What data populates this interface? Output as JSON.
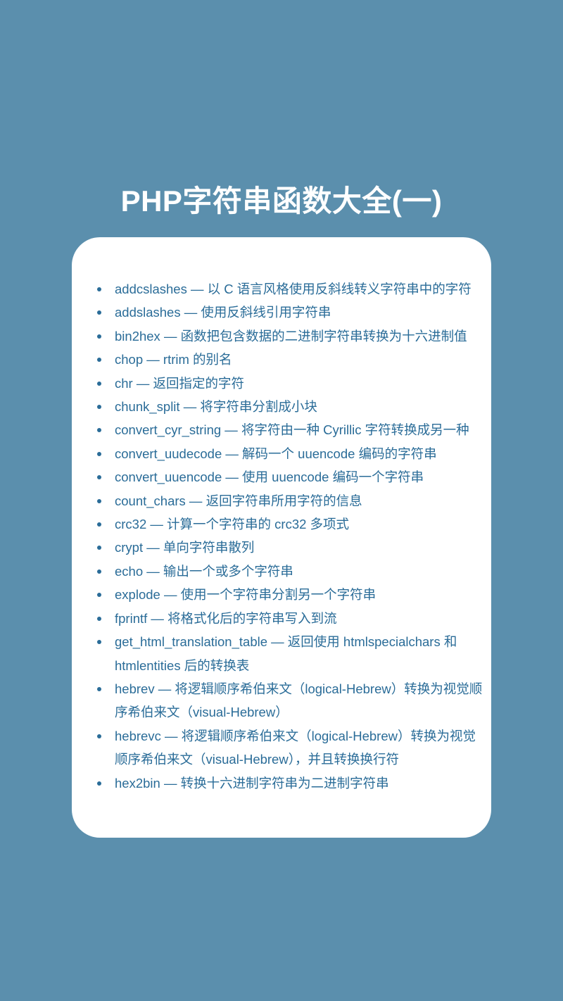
{
  "title": "PHP字符串函数大全(一)",
  "colors": {
    "background": "#5b8fad",
    "card": "#ffffff",
    "text": "#2a6c98",
    "title": "#ffffff"
  },
  "functions": [
    {
      "name": "addcslashes",
      "desc": "以 C 语言风格使用反斜线转义字符串中的字符"
    },
    {
      "name": "addslashes",
      "desc": "使用反斜线引用字符串"
    },
    {
      "name": "bin2hex",
      "desc": "函数把包含数据的二进制字符串转换为十六进制值"
    },
    {
      "name": "chop",
      "desc": "rtrim 的别名"
    },
    {
      "name": "chr",
      "desc": "返回指定的字符"
    },
    {
      "name": "chunk_split",
      "desc": "将字符串分割成小块"
    },
    {
      "name": "convert_cyr_string",
      "desc": "将字符由一种 Cyrillic 字符转换成另一种"
    },
    {
      "name": "convert_uudecode",
      "desc": "解码一个 uuencode 编码的字符串"
    },
    {
      "name": "convert_uuencode",
      "desc": "使用 uuencode 编码一个字符串"
    },
    {
      "name": "count_chars",
      "desc": "返回字符串所用字符的信息"
    },
    {
      "name": "crc32",
      "desc": "计算一个字符串的 crc32 多项式"
    },
    {
      "name": "crypt",
      "desc": "单向字符串散列"
    },
    {
      "name": "echo",
      "desc": "输出一个或多个字符串"
    },
    {
      "name": "explode",
      "desc": "使用一个字符串分割另一个字符串"
    },
    {
      "name": "fprintf",
      "desc": "将格式化后的字符串写入到流"
    },
    {
      "name": "get_html_translation_table",
      "desc": "返回使用 htmlspecialchars 和 htmlentities 后的转换表"
    },
    {
      "name": "hebrev",
      "desc": "将逻辑顺序希伯来文（logical-Hebrew）转换为视觉顺序希伯来文（visual-Hebrew）"
    },
    {
      "name": "hebrevc",
      "desc": "将逻辑顺序希伯来文（logical-Hebrew）转换为视觉顺序希伯来文（visual-Hebrew），并且转换换行符"
    },
    {
      "name": "hex2bin",
      "desc": "转换十六进制字符串为二进制字符串"
    }
  ],
  "separator": " — "
}
